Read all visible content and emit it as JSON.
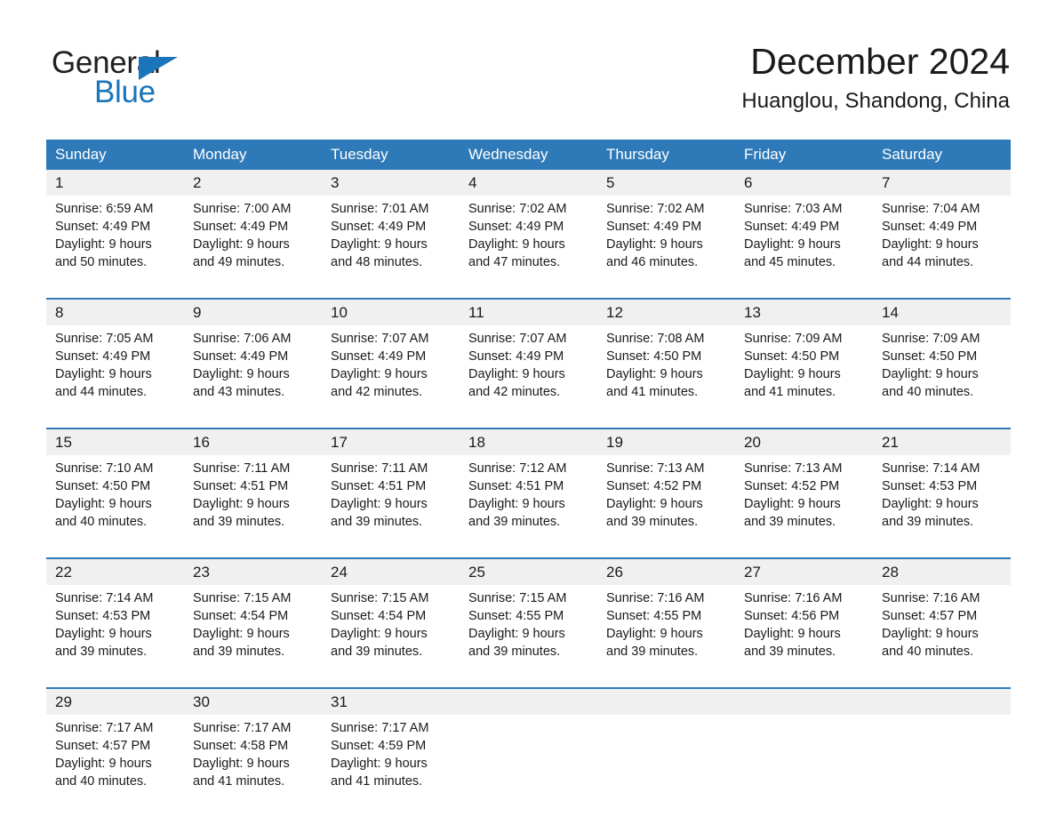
{
  "brand": {
    "name_top": "General",
    "name_bottom": "Blue",
    "triangle_color": "#1b75bb",
    "text_color": "#231f20"
  },
  "header": {
    "title": "December 2024",
    "location": "Huanglou, Shandong, China"
  },
  "theme": {
    "header_blue": "#2e7ab8",
    "row_gray": "#f0f0f0",
    "text": "#1a1a1a"
  },
  "weekdays": [
    "Sunday",
    "Monday",
    "Tuesday",
    "Wednesday",
    "Thursday",
    "Friday",
    "Saturday"
  ],
  "weeks": [
    {
      "days": [
        {
          "num": "1",
          "sunrise": "Sunrise: 6:59 AM",
          "sunset": "Sunset: 4:49 PM",
          "daylight1": "Daylight: 9 hours",
          "daylight2": "and 50 minutes."
        },
        {
          "num": "2",
          "sunrise": "Sunrise: 7:00 AM",
          "sunset": "Sunset: 4:49 PM",
          "daylight1": "Daylight: 9 hours",
          "daylight2": "and 49 minutes."
        },
        {
          "num": "3",
          "sunrise": "Sunrise: 7:01 AM",
          "sunset": "Sunset: 4:49 PM",
          "daylight1": "Daylight: 9 hours",
          "daylight2": "and 48 minutes."
        },
        {
          "num": "4",
          "sunrise": "Sunrise: 7:02 AM",
          "sunset": "Sunset: 4:49 PM",
          "daylight1": "Daylight: 9 hours",
          "daylight2": "and 47 minutes."
        },
        {
          "num": "5",
          "sunrise": "Sunrise: 7:02 AM",
          "sunset": "Sunset: 4:49 PM",
          "daylight1": "Daylight: 9 hours",
          "daylight2": "and 46 minutes."
        },
        {
          "num": "6",
          "sunrise": "Sunrise: 7:03 AM",
          "sunset": "Sunset: 4:49 PM",
          "daylight1": "Daylight: 9 hours",
          "daylight2": "and 45 minutes."
        },
        {
          "num": "7",
          "sunrise": "Sunrise: 7:04 AM",
          "sunset": "Sunset: 4:49 PM",
          "daylight1": "Daylight: 9 hours",
          "daylight2": "and 44 minutes."
        }
      ]
    },
    {
      "days": [
        {
          "num": "8",
          "sunrise": "Sunrise: 7:05 AM",
          "sunset": "Sunset: 4:49 PM",
          "daylight1": "Daylight: 9 hours",
          "daylight2": "and 44 minutes."
        },
        {
          "num": "9",
          "sunrise": "Sunrise: 7:06 AM",
          "sunset": "Sunset: 4:49 PM",
          "daylight1": "Daylight: 9 hours",
          "daylight2": "and 43 minutes."
        },
        {
          "num": "10",
          "sunrise": "Sunrise: 7:07 AM",
          "sunset": "Sunset: 4:49 PM",
          "daylight1": "Daylight: 9 hours",
          "daylight2": "and 42 minutes."
        },
        {
          "num": "11",
          "sunrise": "Sunrise: 7:07 AM",
          "sunset": "Sunset: 4:49 PM",
          "daylight1": "Daylight: 9 hours",
          "daylight2": "and 42 minutes."
        },
        {
          "num": "12",
          "sunrise": "Sunrise: 7:08 AM",
          "sunset": "Sunset: 4:50 PM",
          "daylight1": "Daylight: 9 hours",
          "daylight2": "and 41 minutes."
        },
        {
          "num": "13",
          "sunrise": "Sunrise: 7:09 AM",
          "sunset": "Sunset: 4:50 PM",
          "daylight1": "Daylight: 9 hours",
          "daylight2": "and 41 minutes."
        },
        {
          "num": "14",
          "sunrise": "Sunrise: 7:09 AM",
          "sunset": "Sunset: 4:50 PM",
          "daylight1": "Daylight: 9 hours",
          "daylight2": "and 40 minutes."
        }
      ]
    },
    {
      "days": [
        {
          "num": "15",
          "sunrise": "Sunrise: 7:10 AM",
          "sunset": "Sunset: 4:50 PM",
          "daylight1": "Daylight: 9 hours",
          "daylight2": "and 40 minutes."
        },
        {
          "num": "16",
          "sunrise": "Sunrise: 7:11 AM",
          "sunset": "Sunset: 4:51 PM",
          "daylight1": "Daylight: 9 hours",
          "daylight2": "and 39 minutes."
        },
        {
          "num": "17",
          "sunrise": "Sunrise: 7:11 AM",
          "sunset": "Sunset: 4:51 PM",
          "daylight1": "Daylight: 9 hours",
          "daylight2": "and 39 minutes."
        },
        {
          "num": "18",
          "sunrise": "Sunrise: 7:12 AM",
          "sunset": "Sunset: 4:51 PM",
          "daylight1": "Daylight: 9 hours",
          "daylight2": "and 39 minutes."
        },
        {
          "num": "19",
          "sunrise": "Sunrise: 7:13 AM",
          "sunset": "Sunset: 4:52 PM",
          "daylight1": "Daylight: 9 hours",
          "daylight2": "and 39 minutes."
        },
        {
          "num": "20",
          "sunrise": "Sunrise: 7:13 AM",
          "sunset": "Sunset: 4:52 PM",
          "daylight1": "Daylight: 9 hours",
          "daylight2": "and 39 minutes."
        },
        {
          "num": "21",
          "sunrise": "Sunrise: 7:14 AM",
          "sunset": "Sunset: 4:53 PM",
          "daylight1": "Daylight: 9 hours",
          "daylight2": "and 39 minutes."
        }
      ]
    },
    {
      "days": [
        {
          "num": "22",
          "sunrise": "Sunrise: 7:14 AM",
          "sunset": "Sunset: 4:53 PM",
          "daylight1": "Daylight: 9 hours",
          "daylight2": "and 39 minutes."
        },
        {
          "num": "23",
          "sunrise": "Sunrise: 7:15 AM",
          "sunset": "Sunset: 4:54 PM",
          "daylight1": "Daylight: 9 hours",
          "daylight2": "and 39 minutes."
        },
        {
          "num": "24",
          "sunrise": "Sunrise: 7:15 AM",
          "sunset": "Sunset: 4:54 PM",
          "daylight1": "Daylight: 9 hours",
          "daylight2": "and 39 minutes."
        },
        {
          "num": "25",
          "sunrise": "Sunrise: 7:15 AM",
          "sunset": "Sunset: 4:55 PM",
          "daylight1": "Daylight: 9 hours",
          "daylight2": "and 39 minutes."
        },
        {
          "num": "26",
          "sunrise": "Sunrise: 7:16 AM",
          "sunset": "Sunset: 4:55 PM",
          "daylight1": "Daylight: 9 hours",
          "daylight2": "and 39 minutes."
        },
        {
          "num": "27",
          "sunrise": "Sunrise: 7:16 AM",
          "sunset": "Sunset: 4:56 PM",
          "daylight1": "Daylight: 9 hours",
          "daylight2": "and 39 minutes."
        },
        {
          "num": "28",
          "sunrise": "Sunrise: 7:16 AM",
          "sunset": "Sunset: 4:57 PM",
          "daylight1": "Daylight: 9 hours",
          "daylight2": "and 40 minutes."
        }
      ]
    },
    {
      "days": [
        {
          "num": "29",
          "sunrise": "Sunrise: 7:17 AM",
          "sunset": "Sunset: 4:57 PM",
          "daylight1": "Daylight: 9 hours",
          "daylight2": "and 40 minutes."
        },
        {
          "num": "30",
          "sunrise": "Sunrise: 7:17 AM",
          "sunset": "Sunset: 4:58 PM",
          "daylight1": "Daylight: 9 hours",
          "daylight2": "and 41 minutes."
        },
        {
          "num": "31",
          "sunrise": "Sunrise: 7:17 AM",
          "sunset": "Sunset: 4:59 PM",
          "daylight1": "Daylight: 9 hours",
          "daylight2": "and 41 minutes."
        },
        {
          "num": "",
          "sunrise": "",
          "sunset": "",
          "daylight1": "",
          "daylight2": ""
        },
        {
          "num": "",
          "sunrise": "",
          "sunset": "",
          "daylight1": "",
          "daylight2": ""
        },
        {
          "num": "",
          "sunrise": "",
          "sunset": "",
          "daylight1": "",
          "daylight2": ""
        },
        {
          "num": "",
          "sunrise": "",
          "sunset": "",
          "daylight1": "",
          "daylight2": ""
        }
      ]
    }
  ]
}
